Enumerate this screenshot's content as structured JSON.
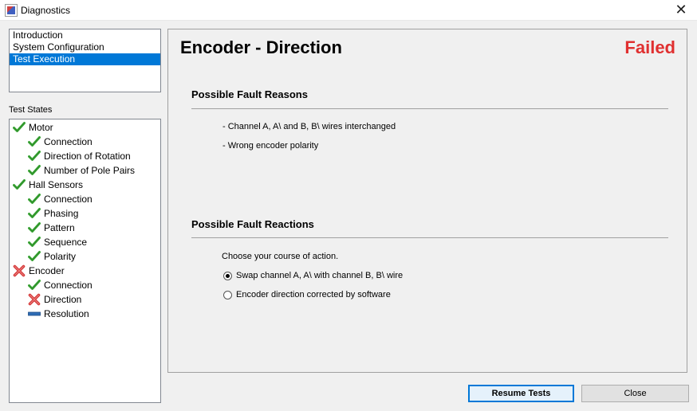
{
  "window": {
    "title": "Diagnostics",
    "close_glyph": "✕",
    "icon": "app-icon"
  },
  "nav": {
    "items": [
      {
        "label": "Introduction",
        "selected": false
      },
      {
        "label": "System Configuration",
        "selected": false
      },
      {
        "label": "Test Execution",
        "selected": true
      }
    ],
    "selected_color": "#0078d7"
  },
  "test_states": {
    "label": "Test States",
    "items": [
      {
        "label": "Motor",
        "status": "passed",
        "icon": "check-icon",
        "level": 0
      },
      {
        "label": "Connection",
        "status": "passed",
        "icon": "check-icon",
        "level": 1
      },
      {
        "label": "Direction of Rotation",
        "status": "passed",
        "icon": "check-icon",
        "level": 1
      },
      {
        "label": "Number of Pole Pairs",
        "status": "passed",
        "icon": "check-icon",
        "level": 1
      },
      {
        "label": "Hall Sensors",
        "status": "passed",
        "icon": "check-icon",
        "level": 0
      },
      {
        "label": "Connection",
        "status": "passed",
        "icon": "check-icon",
        "level": 1
      },
      {
        "label": "Phasing",
        "status": "passed",
        "icon": "check-icon",
        "level": 1
      },
      {
        "label": "Pattern",
        "status": "passed",
        "icon": "check-icon",
        "level": 1
      },
      {
        "label": "Sequence",
        "status": "passed",
        "icon": "check-icon",
        "level": 1
      },
      {
        "label": "Polarity",
        "status": "passed",
        "icon": "check-icon",
        "level": 1
      },
      {
        "label": "Encoder",
        "status": "failed",
        "icon": "cross-icon",
        "level": 0
      },
      {
        "label": "Connection",
        "status": "passed",
        "icon": "check-icon",
        "level": 1
      },
      {
        "label": "Direction",
        "status": "failed",
        "icon": "cross-icon",
        "level": 1
      },
      {
        "label": "Resolution",
        "status": "pending",
        "icon": "pending-bar-icon",
        "level": 1
      }
    ],
    "colors": {
      "passed": "#3aa635",
      "failed": "#d63a3a",
      "pending": "#2f6db5"
    }
  },
  "panel": {
    "title": "Encoder - Direction",
    "status": "Failed",
    "status_color": "#e03030",
    "fault_reasons": {
      "heading": "Possible Fault Reasons",
      "items": [
        "- Channel A, A\\ and B, B\\ wires interchanged",
        "- Wrong encoder polarity"
      ]
    },
    "fault_reactions": {
      "heading": "Possible Fault Reactions",
      "prompt": "Choose your course of action.",
      "options": [
        {
          "label": "Swap channel A, A\\ with channel B, B\\ wire",
          "selected": true
        },
        {
          "label": "Encoder direction corrected by software",
          "selected": false
        }
      ]
    }
  },
  "buttons": {
    "resume": "Resume Tests",
    "close": "Close"
  }
}
